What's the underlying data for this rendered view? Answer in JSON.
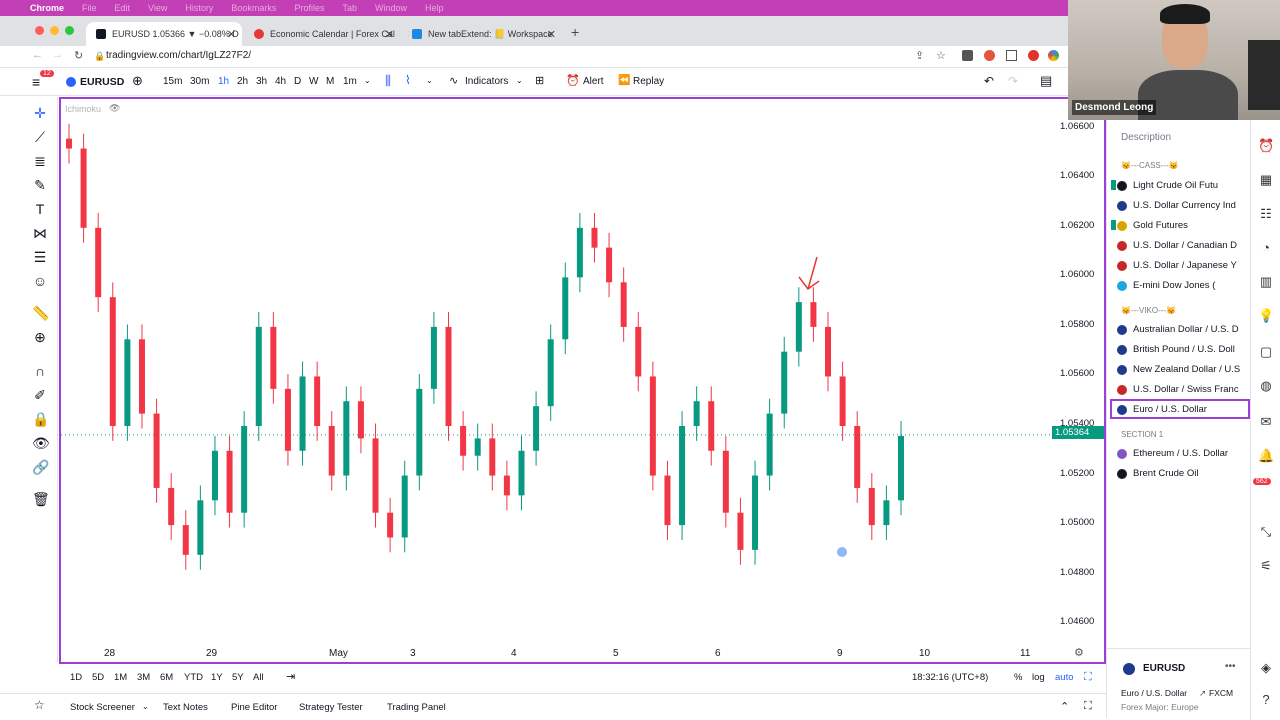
{
  "mac": {
    "menu": [
      "Chrome",
      "File",
      "Edit",
      "View",
      "History",
      "Bookmarks",
      "Profiles",
      "Tab",
      "Window",
      "Help"
    ]
  },
  "browser": {
    "tabs": [
      {
        "label": "EURUSD 1.05366 ▼ −0.08% D",
        "active": true,
        "color": "#131722"
      },
      {
        "label": "Economic Calendar | Forex Cal",
        "active": false,
        "color": "#e53935"
      },
      {
        "label": "New tabExtend: 📒 Workspace",
        "active": false,
        "color": "#1e88e5"
      }
    ],
    "url": "tradingview.com/chart/IgLZ27F2/",
    "badge": "12"
  },
  "toolbar": {
    "symbol": "EURUSD",
    "intervals": [
      "15m",
      "30m",
      "1h",
      "2h",
      "3h",
      "4h",
      "D",
      "W",
      "M",
      "1m"
    ],
    "active_interval": "1h",
    "indicators_label": "Indicators",
    "alert_label": "Alert",
    "replay_label": "Replay"
  },
  "chart": {
    "indicator_label": "Ichimoku",
    "current_price": "1.05364",
    "accent": "#9b3fd6",
    "up_color": "#089981",
    "down_color": "#f23645"
  },
  "chart_data": {
    "type": "candlestick",
    "y_ticks": [
      "1.06600",
      "1.06400",
      "1.06200",
      "1.06000",
      "1.05800",
      "1.05600",
      "1.05400",
      "1.05200",
      "1.05000",
      "1.04800",
      "1.04600"
    ],
    "x_ticks": [
      "28",
      "29",
      "May",
      "3",
      "4",
      "5",
      "6",
      "9",
      "10",
      "11"
    ],
    "ylim": [
      1.0452,
      1.0672
    ],
    "last_price": 1.05364
  },
  "watchlist": {
    "header": "Description",
    "sections": [
      {
        "title": "😽---CASS---😽",
        "items": [
          "Light Crude Oil Futu",
          "U.S. Dollar Currency Ind",
          "Gold Futures",
          "U.S. Dollar / Canadian D",
          "U.S. Dollar / Japanese Y",
          "E-mini Dow Jones ("
        ]
      },
      {
        "title": "😽---VIKO---😽",
        "items": [
          "Australian Dollar / U.S. D",
          "British Pound / U.S. Doll",
          "New Zealand Dollar / U.S",
          "U.S. Dollar / Swiss Franc",
          "Euro / U.S. Dollar"
        ]
      },
      {
        "title": "SECTION 1",
        "items": [
          "Ethereum / U.S. Dollar",
          "Brent Crude Oil"
        ]
      }
    ],
    "selected": "Euro / U.S. Dollar"
  },
  "details": {
    "symbol": "EURUSD",
    "name": "Euro / U.S. Dollar",
    "exchange": "FXCM",
    "category": "Forex Major: Europe"
  },
  "range": {
    "buttons": [
      "1D",
      "5D",
      "1M",
      "3M",
      "6M",
      "YTD",
      "1Y",
      "5Y",
      "All"
    ],
    "time": "18:32:16 (UTC+8)",
    "percent": "%",
    "log": "log",
    "auto": "auto"
  },
  "bottom": {
    "tabs": [
      "Stock Screener",
      "Text Notes",
      "Pine Editor",
      "Strategy Tester",
      "Trading Panel"
    ]
  },
  "webcam": {
    "name": "Desmond Leong"
  },
  "right_badges": [
    "562"
  ]
}
